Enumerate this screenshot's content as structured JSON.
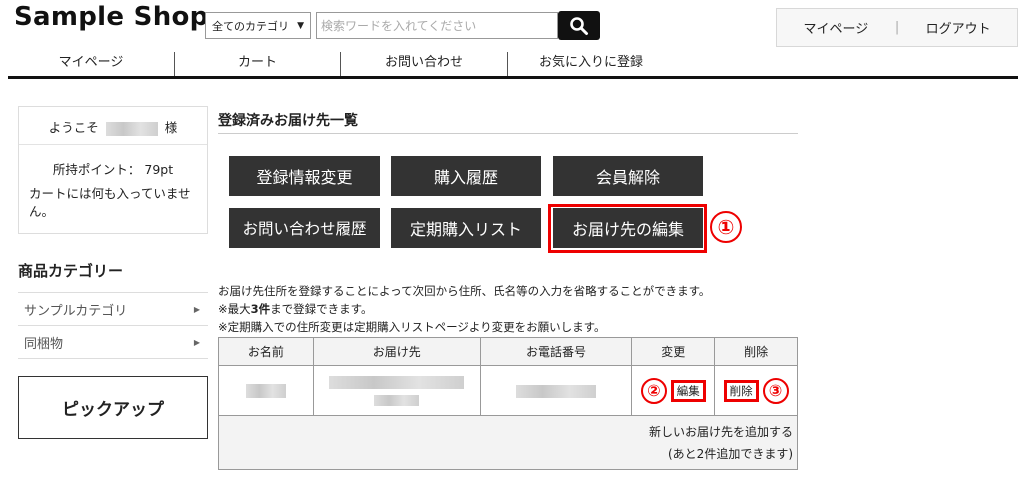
{
  "header": {
    "logo": "Sample Shop",
    "category_select": "全てのカテゴリ",
    "search_placeholder": "検索ワードを入れてください",
    "mypage": "マイページ",
    "separator": "|",
    "logout": "ログアウト"
  },
  "nav": [
    "マイページ",
    "カート",
    "お問い合わせ",
    "お気に入りに登録"
  ],
  "sidebar": {
    "welcome_prefix": "ようこそ",
    "welcome_suffix": "様",
    "points": "所持ポイント： 79pt",
    "cart_empty": "カートには何も入っていません。",
    "category_heading": "商品カテゴリー",
    "categories": [
      "サンプルカテゴリ",
      "同梱物"
    ],
    "pickup": "ピックアップ"
  },
  "main": {
    "title": "登録済みお届け先一覧",
    "buttons": [
      "登録情報変更",
      "購入履歴",
      "会員解除",
      "お問い合わせ履歴",
      "定期購入リスト",
      "お届け先の編集"
    ],
    "annotations": [
      "①",
      "②",
      "③"
    ],
    "notes": {
      "line1": "お届け先住所を登録することによって次回から住所、氏名等の入力を省略することができます。",
      "line2_prefix": "※最大",
      "line2_bold": "3件",
      "line2_suffix": "まで登録できます。",
      "line3": "※定期購入での住所変更は定期購入リストページより変更をお願いします。"
    },
    "table": {
      "headers": [
        "お名前",
        "お届け先",
        "お電話番号",
        "変更",
        "削除"
      ],
      "edit_label": "編集",
      "delete_label": "削除",
      "add_new": "新しいお届け先を追加する",
      "remaining": "(あと2件追加できます)"
    }
  },
  "colors": {
    "button_bg": "#333333",
    "highlight": "#e00000"
  }
}
